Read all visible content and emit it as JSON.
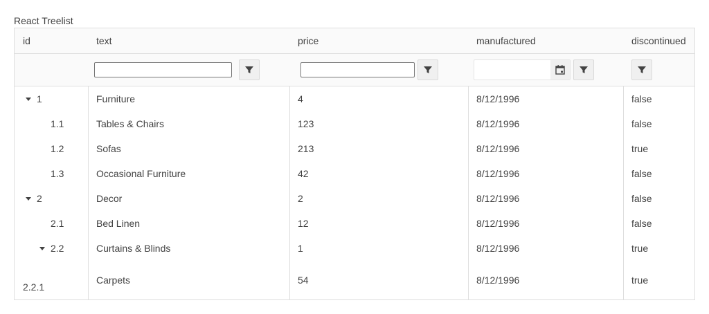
{
  "title": "React Treelist",
  "columns": [
    {
      "label": "id"
    },
    {
      "label": "text"
    },
    {
      "label": "price"
    },
    {
      "label": "manufactured"
    },
    {
      "label": "discontinued"
    }
  ],
  "filters": {
    "text_value": "",
    "price_value": "",
    "date_value": ""
  },
  "rows": [
    {
      "id": "1",
      "text": "Furniture",
      "price": "4",
      "manufactured": "8/12/1996",
      "discontinued": "false",
      "level": 0,
      "expanded": true
    },
    {
      "id": "1.1",
      "text": "Tables & Chairs",
      "price": "123",
      "manufactured": "8/12/1996",
      "discontinued": "false",
      "level": 1
    },
    {
      "id": "1.2",
      "text": "Sofas",
      "price": "213",
      "manufactured": "8/12/1996",
      "discontinued": "true",
      "level": 1
    },
    {
      "id": "1.3",
      "text": "Occasional Furniture",
      "price": "42",
      "manufactured": "8/12/1996",
      "discontinued": "false",
      "level": 1
    },
    {
      "id": "2",
      "text": "Decor",
      "price": "2",
      "manufactured": "8/12/1996",
      "discontinued": "false",
      "level": 0,
      "expanded": true
    },
    {
      "id": "2.1",
      "text": "Bed Linen",
      "price": "12",
      "manufactured": "8/12/1996",
      "discontinued": "false",
      "level": 1
    },
    {
      "id": "2.2",
      "text": "Curtains & Blinds",
      "price": "1",
      "manufactured": "8/12/1996",
      "discontinued": "true",
      "level": 1,
      "expanded": true
    },
    {
      "id": "2.2.1",
      "text": "Carpets",
      "price": "54",
      "manufactured": "8/12/1996",
      "discontinued": "true",
      "level": 2
    }
  ],
  "icons": {
    "filter": "filter-icon",
    "calendar": "calendar-icon",
    "expand": "caret-down-icon"
  },
  "colors": {
    "border": "#dedede",
    "header_bg": "#fafafa",
    "text": "#424242"
  }
}
